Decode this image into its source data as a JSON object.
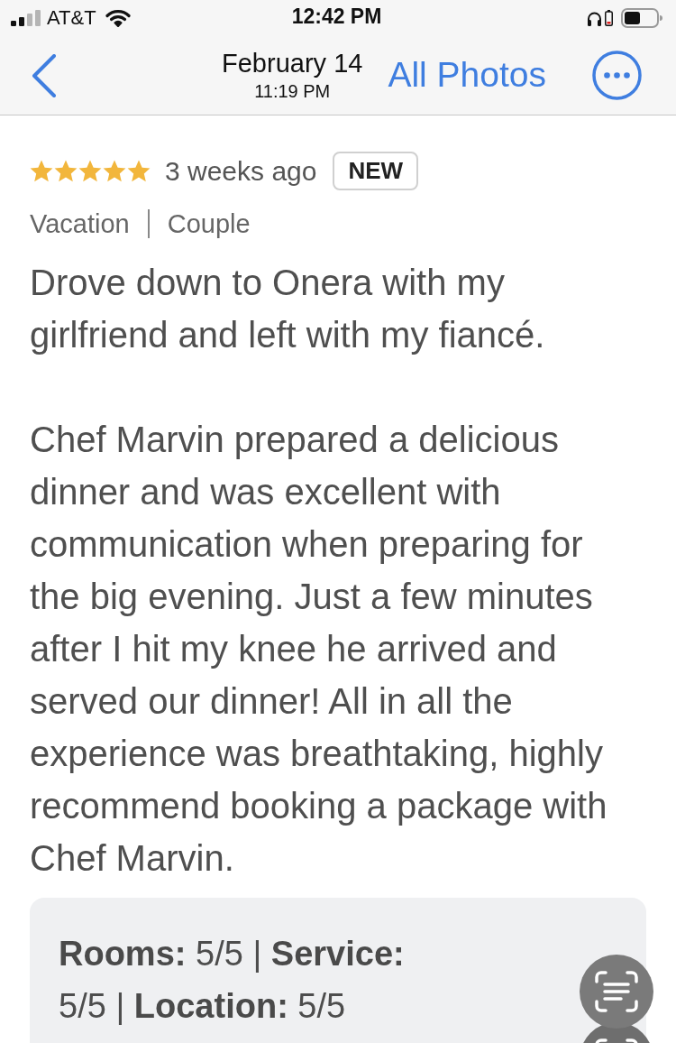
{
  "status_bar": {
    "carrier": "AT&T",
    "time": "12:42 PM"
  },
  "nav_bar": {
    "title": "February 14",
    "subtitle": "11:19 PM",
    "link": "All Photos"
  },
  "review": {
    "stars": 5,
    "age": "3 weeks ago",
    "badge": "NEW",
    "tags": [
      "Vacation",
      "Couple"
    ],
    "paragraphs": [
      "Drove down to Onera with my girlfriend and left with my fiancé.",
      "Chef Marvin prepared a delicious dinner and was excellent with communication when preparing for the big evening. Just a few minutes after I hit my knee he arrived and served our dinner! All in all the experience was breathtaking, highly recommend booking a package with Chef Marvin."
    ],
    "ratings_summary": "**Rooms:** 5/5 | **Service:** 5/5 | **Location:** 5/5"
  }
}
